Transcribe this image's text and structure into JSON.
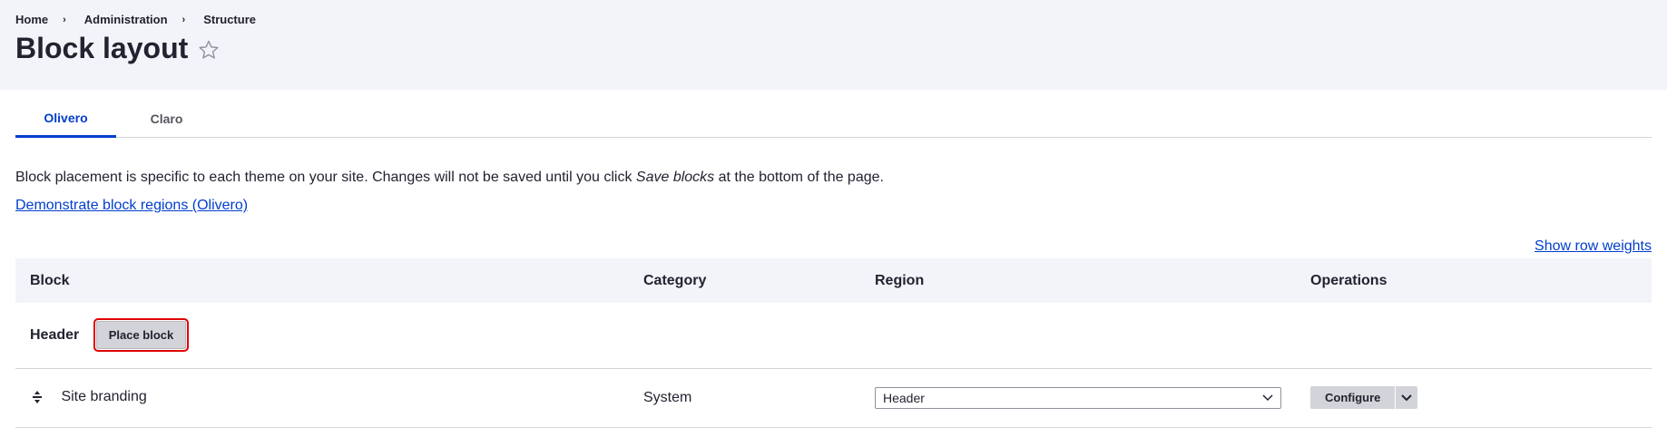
{
  "breadcrumb": {
    "items": [
      "Home",
      "Administration",
      "Structure"
    ],
    "separator": "›"
  },
  "page": {
    "title": "Block layout"
  },
  "tabs": [
    {
      "label": "Olivero",
      "active": true
    },
    {
      "label": "Claro",
      "active": false
    }
  ],
  "description": {
    "before": "Block placement is specific to each theme on your site. Changes will not be saved until you click ",
    "emphasis": "Save blocks",
    "after": " at the bottom of the page."
  },
  "links": {
    "demonstrate": "Demonstrate block regions (Olivero)",
    "show_weights": "Show row weights"
  },
  "table": {
    "headers": [
      "Block",
      "Category",
      "Region",
      "Operations"
    ],
    "region": {
      "title": "Header",
      "place_block_label": "Place block"
    },
    "rows": [
      {
        "block": "Site branding",
        "category": "System",
        "region": "Header",
        "operation": "Configure"
      }
    ]
  },
  "colors": {
    "accent": "#003ecc",
    "header_bg": "#f3f4f9",
    "highlight": "#e00000"
  },
  "icons": {
    "favorite": "star-outline-icon",
    "drag": "drag-handle-icon",
    "select": "chevron-down-icon",
    "ops": "chevron-down-icon"
  }
}
